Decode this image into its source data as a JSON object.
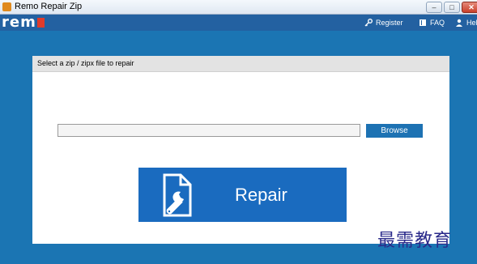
{
  "window": {
    "title": "Remo Repair Zip",
    "minimize_glyph": "–",
    "maximize_glyph": "□",
    "close_glyph": "✕"
  },
  "header": {
    "logo_text": "rem",
    "nav": {
      "register": "Register",
      "faq": "FAQ",
      "help": "Help"
    }
  },
  "panel": {
    "title": "Select a zip / zipx file to repair",
    "file_input_value": "",
    "browse_label": "Browse",
    "repair_label": "Repair"
  },
  "watermark": "最需教育",
  "colors": {
    "background": "#1b75b3",
    "appbar": "#2361a1",
    "accent_button": "#1d72b3",
    "repair_button": "#1a6bbf",
    "logo_accent": "#e03b2b"
  }
}
